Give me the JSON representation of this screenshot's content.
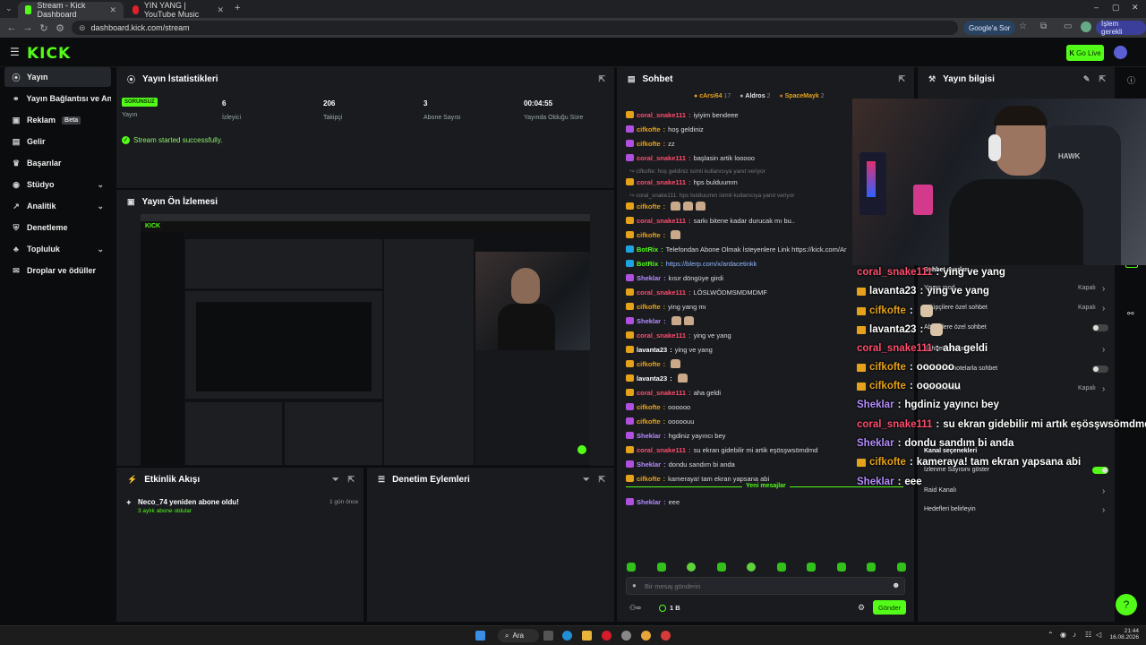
{
  "browser": {
    "tabs": [
      {
        "title": "Stream - Kick Dashboard",
        "active": true
      },
      {
        "title": "YIN YANG | YouTube Music",
        "active": false
      }
    ],
    "url": "dashboard.kick.com/stream",
    "search_pill": "Google'a Sor",
    "work_pill": "İşlem gerekli"
  },
  "header": {
    "logo": "KICK",
    "go_live": "Go Live"
  },
  "sidebar": {
    "items": [
      {
        "label": "Yayın",
        "icon": "broadcast-icon",
        "active": true
      },
      {
        "label": "Yayın Bağlantısı ve Anahtar",
        "icon": "link-icon"
      },
      {
        "label": "Reklam",
        "icon": "ad-icon",
        "badge": "Beta"
      },
      {
        "label": "Gelir",
        "icon": "dollar-icon"
      },
      {
        "label": "Başarılar",
        "icon": "trophy-icon"
      },
      {
        "label": "Stüdyo",
        "icon": "studio-icon",
        "chevron": true
      },
      {
        "label": "Analitik",
        "icon": "chart-icon",
        "chevron": true
      },
      {
        "label": "Denetleme",
        "icon": "shield-icon"
      },
      {
        "label": "Topluluk",
        "icon": "community-icon",
        "chevron": true
      },
      {
        "label": "Droplar ve ödüller",
        "icon": "gift-icon"
      }
    ]
  },
  "stats_panel": {
    "title": "Yayın İstatistikleri",
    "status_badge": "SORUNSUZ",
    "stats": [
      {
        "label": "Yayın",
        "value": ""
      },
      {
        "label": "İzleyici",
        "value": "6"
      },
      {
        "label": "Takipçi",
        "value": "206"
      },
      {
        "label": "Abone Sayısı",
        "value": "3"
      },
      {
        "label": "Yayında Olduğu Süre",
        "value": "00:04:55"
      }
    ],
    "success_msg": "Stream started successfully."
  },
  "preview_panel": {
    "title": "Yayın Ön İzlemesi"
  },
  "activity_panel": {
    "title": "Etkinlik Akışı",
    "event": {
      "title": "Neco_74 yeniden abone oldu!",
      "sub": "3 aylık abone oldular",
      "time": "1 gün önce"
    }
  },
  "moderation_panel": {
    "title": "Denetim Eylemleri"
  },
  "chat": {
    "title": "Sohbet",
    "top_gifters": [
      {
        "name": "cArsi64",
        "count": "17"
      },
      {
        "name": "Aldros",
        "count": "2"
      },
      {
        "name": "SpaceMayk",
        "count": "2"
      }
    ],
    "messages": [
      {
        "user": "coral_snake111",
        "text": "iyiyim bendeee",
        "color": "#ff4d6d",
        "badge": "#e6a21a"
      },
      {
        "user": "cifkofte",
        "text": "hoş geldiniz",
        "color": "#e6a21a",
        "badge": "#b04fe0"
      },
      {
        "user": "cifkofte",
        "text": "zz",
        "color": "#e6a21a",
        "badge": "#b04fe0"
      },
      {
        "user": "coral_snake111",
        "text": "başlasin artik looooo",
        "color": "#ff4d6d",
        "badge": "#b04fe0"
      },
      {
        "user": "coral_snake111",
        "text": "hps bulduumm",
        "color": "#ff4d6d",
        "badge": "#e6a21a",
        "reply": "↪ cifkofte: hoş geldiniz isimli kullanıcıya yanıt veriyor"
      },
      {
        "user": "cifkofte",
        "text": "",
        "color": "#e6a21a",
        "badge": "#e6a21a",
        "reply": "↪ coral_snake111: hps bulduumm isimli kullanıcıya yanıt veriyor",
        "emotes": 3
      },
      {
        "user": "coral_snake111",
        "text": "sarkı bitene kadar durucak mı bu..",
        "color": "#ff4d6d",
        "badge": "#e6a21a"
      },
      {
        "user": "cifkofte",
        "text": "",
        "color": "#e6a21a",
        "badge": "#e6a21a",
        "emotes": 1
      },
      {
        "user": "BotRix",
        "text": "Telefondan Abone Olmak İsteyenlere Link https://kick.com/Ar",
        "color": "#53fc18",
        "badge": "#1fa3e0"
      },
      {
        "user": "BotRix",
        "text": "https://blerp.com/x/ardacetinkk",
        "color": "#53fc18",
        "badge": "#1fa3e0"
      },
      {
        "user": "Sheklar",
        "text": "kısır döngüye girdi",
        "color": "#b48cff",
        "badge": "#b04fe0"
      },
      {
        "user": "coral_snake111",
        "text": "LÖSLWÖDMSMDMDMF",
        "color": "#ff4d6d",
        "badge": "#e6a21a"
      },
      {
        "user": "cifkofte",
        "text": "ying yang mı",
        "color": "#e6a21a",
        "badge": "#e6a21a"
      },
      {
        "user": "Sheklar",
        "text": "",
        "color": "#b48cff",
        "badge": "#b04fe0",
        "emotes": 2
      },
      {
        "user": "coral_snake111",
        "text": "ying ve yang",
        "color": "#ff4d6d",
        "badge": "#e6a21a"
      },
      {
        "user": "lavanta23",
        "text": "ying ve yang",
        "color": "#ffffff",
        "badge": "#e6a21a"
      },
      {
        "user": "cifkofte",
        "text": "",
        "color": "#e6a21a",
        "badge": "#e6a21a",
        "emotes": 1
      },
      {
        "user": "lavanta23",
        "text": "",
        "color": "#ffffff",
        "badge": "#e6a21a",
        "emotes": 1
      },
      {
        "user": "coral_snake111",
        "text": "aha geldi",
        "color": "#ff4d6d",
        "badge": "#e6a21a"
      },
      {
        "user": "cifkofte",
        "text": "oooooo",
        "color": "#e6a21a",
        "badge": "#b04fe0"
      },
      {
        "user": "cifkofte",
        "text": "ooooouu",
        "color": "#e6a21a",
        "badge": "#b04fe0"
      },
      {
        "user": "Sheklar",
        "text": "hgdiniz yayıncı bey",
        "color": "#b48cff",
        "badge": "#b04fe0"
      },
      {
        "user": "coral_snake111",
        "text": "su ekran gidebilir mi artik eşösşwsömdmd",
        "color": "#ff4d6d",
        "badge": "#e6a21a"
      },
      {
        "user": "Sheklar",
        "text": "dondu sandım bi anda",
        "color": "#b48cff",
        "badge": "#b04fe0"
      },
      {
        "user": "cifkofte",
        "text": "kameraya! tam ekran yapsana abi",
        "color": "#e6a21a",
        "badge": "#e6a21a"
      }
    ],
    "new_messages": "Yeni mesajlar",
    "last_message": {
      "user": "Sheklar",
      "text": "eee",
      "color": "#b48cff",
      "badge": "#b04fe0"
    },
    "input_placeholder": "Bir mesaj gönderin",
    "points": "1 B",
    "send": "Gönder"
  },
  "stream_info": {
    "title": "Yayın bilgisi",
    "settings": [
      {
        "label": "Sohbet ayarları",
        "value": ""
      },
      {
        "label": "Yavaş mod",
        "value": "Kapalı"
      },
      {
        "label": "Takipçilere özel sohbet",
        "value": "Kapalı"
      },
      {
        "label": "Abonelere özel sohbet",
        "toggle": false
      },
      {
        "label": "Sohbet kuralları",
        "value": ""
      },
      {
        "label": "Sadece Emotelarla sohbet",
        "toggle": false
      },
      {
        "label": "Bot koruması",
        "value": "Kapalı"
      },
      {
        "label": "Kanal seçenekleri",
        "value": ""
      },
      {
        "label": "İzlenme Sayısını göster",
        "toggle": true
      },
      {
        "label": "Raid Kanalı",
        "value": ""
      },
      {
        "label": "Hedefleri belirleyin",
        "value": ""
      }
    ]
  },
  "overlay_chat": [
    {
      "user": "coral_snake111",
      "text": "ying ve yang",
      "color": "#ff4d6d",
      "badge": false
    },
    {
      "user": "lavanta23",
      "text": "ying ve yang",
      "color": "#ffffff",
      "badge": true
    },
    {
      "user": "cifkofte",
      "text": "",
      "color": "#e6a21a",
      "badge": true
    },
    {
      "user": "lavanta23",
      "text": "",
      "color": "#ffffff",
      "badge": true
    },
    {
      "user": "coral_snake111",
      "text": "aha geldi",
      "color": "#ff4d6d",
      "badge": false
    },
    {
      "user": "cifkofte",
      "text": "oooooo",
      "color": "#e6a21a",
      "badge": true
    },
    {
      "user": "cifkofte",
      "text": "ooooouu",
      "color": "#e6a21a",
      "badge": true
    },
    {
      "user": "Sheklar",
      "text": "hgdiniz yayıncı bey",
      "color": "#b48cff",
      "badge": false
    },
    {
      "user": "coral_snake111",
      "text": "su ekran gidebilir mi artık eşösşwsömdmd",
      "color": "#ff4d6d",
      "badge": false
    },
    {
      "user": "Sheklar",
      "text": "dondu sandım bi anda",
      "color": "#b48cff",
      "badge": false
    },
    {
      "user": "cifkofte",
      "text": "kameraya! tam ekran yapsana abi",
      "color": "#e6a21a",
      "badge": true
    },
    {
      "user": "Sheklar",
      "text": "eee",
      "color": "#b48cff",
      "badge": false
    }
  ],
  "taskbar": {
    "search": "Ara",
    "time": "21:44",
    "date": "16.08.2026"
  }
}
